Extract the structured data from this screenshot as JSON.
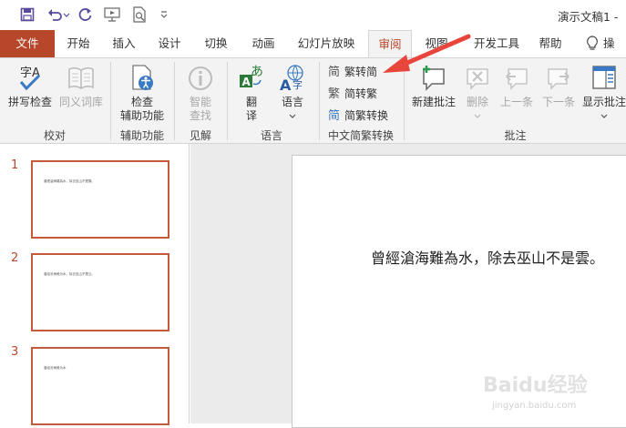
{
  "window": {
    "doc_title": "演示文稿1 -"
  },
  "qat": {
    "icons": [
      "save-icon",
      "undo-icon",
      "redo-icon",
      "present-from-start-icon",
      "print-preview-icon",
      "customize-qat-icon"
    ]
  },
  "tabs": [
    {
      "label": "文件"
    },
    {
      "label": "开始"
    },
    {
      "label": "插入"
    },
    {
      "label": "设计"
    },
    {
      "label": "切换"
    },
    {
      "label": "动画"
    },
    {
      "label": "幻灯片放映"
    },
    {
      "label": "审阅"
    },
    {
      "label": "视图"
    },
    {
      "label": "开发工具"
    },
    {
      "label": "帮助"
    },
    {
      "label": "操"
    }
  ],
  "ribbon": {
    "spell_check": "拼写检查",
    "thesaurus": "同义词库",
    "check_access_1": "检查",
    "check_access_2": "辅助功能",
    "smart_lookup_1": "智能",
    "smart_lookup_2": "查找",
    "translate_1": "翻",
    "translate_2": "译",
    "language": "语言",
    "trad_to_simp": "繁转简",
    "simp_to_trad": "简转繁",
    "simp_trad_convert": "简繁转换",
    "new_comment": "新建批注",
    "delete": "删除",
    "previous": "上一条",
    "next": "下一条",
    "show_comments": "显示批注",
    "groups": {
      "proofing": "校对",
      "accessibility": "辅助功能",
      "insights": "见解",
      "language": "语言",
      "chinese_conversion": "中文简繁转换",
      "comments": "批注"
    }
  },
  "slides": [
    {
      "number": "1",
      "text": "曾經滄海難為水，除去巫山不是雲。"
    },
    {
      "number": "2",
      "text": "曾经沧海难为水，除去巫山不是云。"
    },
    {
      "number": "3",
      "text": "曾经沧海难为水"
    }
  ],
  "current_slide": {
    "text": "曾經滄海難為水，除去巫山不是雲。"
  },
  "watermark": {
    "main": "Baidu经验",
    "sub": "jingyan.baidu.com"
  },
  "colors": {
    "accent": "#b7472a",
    "arrow": "#e8463c"
  }
}
